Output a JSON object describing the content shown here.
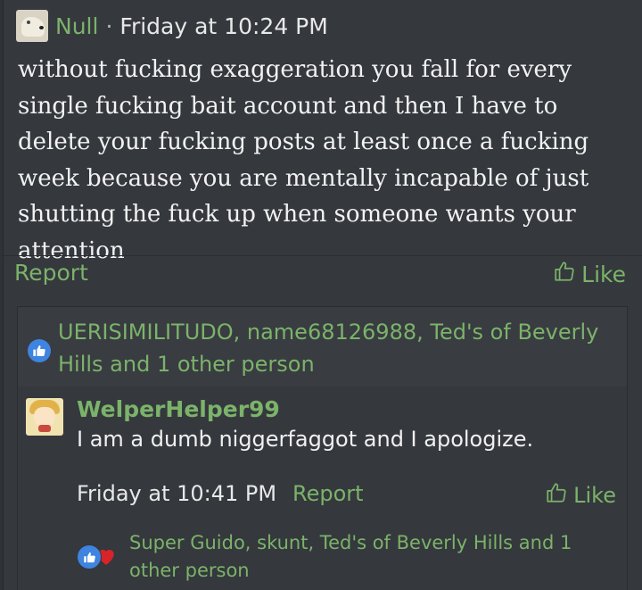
{
  "post": {
    "author": "Null",
    "separator": "·",
    "time": "Friday at 10:24 PM",
    "message": "without fucking exaggeration you fall for every single fucking bait account and then I have to delete your fucking posts at least once a fucking week because you are mentally incapable of just shutting the fuck up when someone wants your attention",
    "report_label": "Report",
    "like_label": "Like",
    "reactions_text": "UERISIMILITUDO, name68126988, Ted's of Beverly Hills and 1 other person"
  },
  "reply": {
    "author": "WelperHelper99",
    "message": "I am a dumb niggerfaggot and I apologize.",
    "time": "Friday at 10:41 PM",
    "report_label": "Report",
    "like_label": "Like",
    "reactions_text": "Super Guido, skunt, Ted's of Beverly Hills and 1 other person"
  },
  "icons": {
    "post_like": "thumbs-up-icon",
    "like_reaction": "like-reaction-icon",
    "love_reaction": "heart-reaction-icon"
  },
  "colors": {
    "accent_green": "#7bb36a",
    "background": "#35383d",
    "reaction_blue": "#3e84e0",
    "heart_red": "#d8232a"
  }
}
